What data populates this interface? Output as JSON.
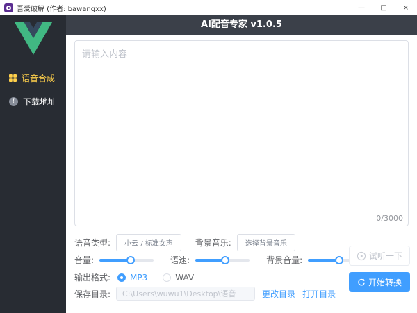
{
  "window": {
    "title": "吾爱破解 (作者: bawangxx)",
    "controls": {
      "minimize": "—",
      "maximize": "□",
      "close": "×"
    }
  },
  "sidebar": {
    "items": [
      {
        "label": "语音合成",
        "icon": "grid-menu-icon",
        "active": true
      },
      {
        "label": "下载地址",
        "icon": "info-icon",
        "active": false
      }
    ]
  },
  "header": {
    "title": "AI配音专家 v1.0.5"
  },
  "editor": {
    "placeholder": "请输入内容",
    "value": "",
    "counter": "0/3000"
  },
  "form": {
    "voice_type": {
      "label": "语音类型:",
      "button": "小云 / 标准女声"
    },
    "bg_music": {
      "label": "背景音乐:",
      "button": "选择背景音乐"
    },
    "sliders": [
      {
        "label": "音量:",
        "percent": 57
      },
      {
        "label": "语速:",
        "percent": 55
      },
      {
        "label": "背景音量:",
        "percent": 57
      }
    ],
    "output_format": {
      "label": "输出格式:",
      "options": [
        {
          "label": "MP3",
          "selected": true
        },
        {
          "label": "WAV",
          "selected": false
        }
      ]
    },
    "save_dir": {
      "label": "保存目录:",
      "value": "C:\\Users\\wuwu1\\Desktop\\语音",
      "links": [
        "更改目录",
        "打开目录"
      ]
    }
  },
  "actions": {
    "preview": "试听一下",
    "convert": "开始转换"
  },
  "icons": {
    "info": "i",
    "preview": "play-circle-icon",
    "convert": "refresh-icon"
  },
  "colors": {
    "accent": "#409eff",
    "sidebar_active": "#ffd04b",
    "header_bg": "#3b4049",
    "sidebar_bg": "#282c33"
  }
}
